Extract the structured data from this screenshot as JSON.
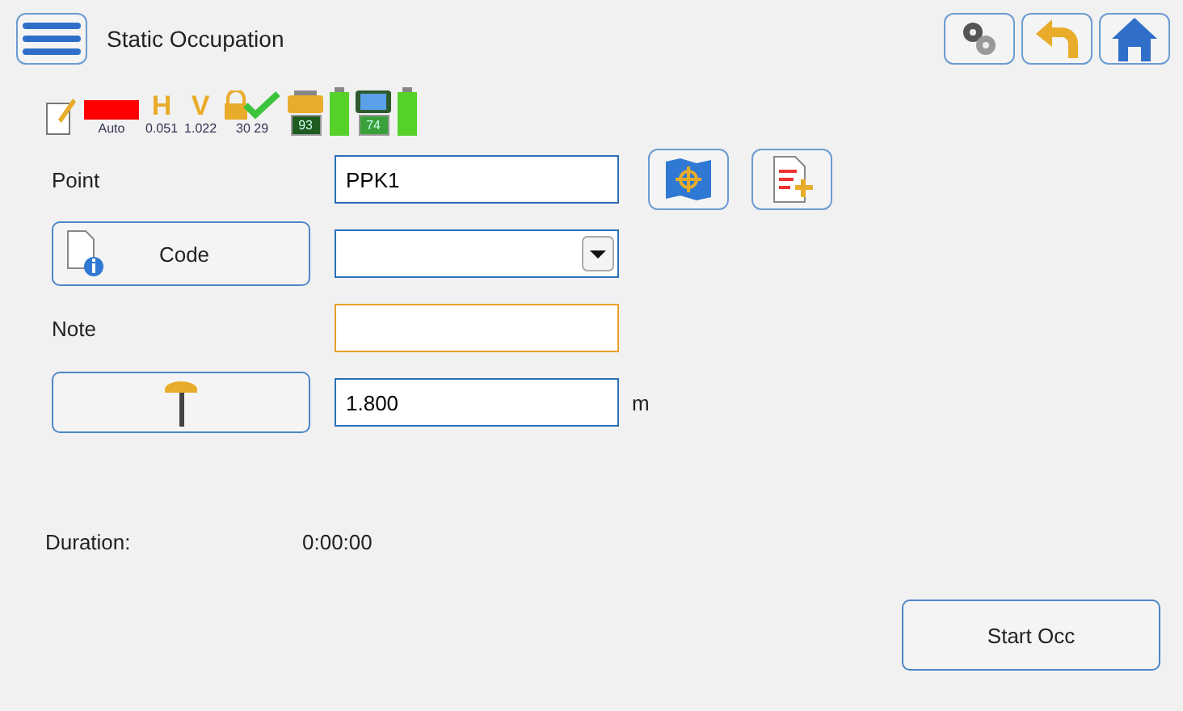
{
  "title": "Static Occupation",
  "status": {
    "mode": "Auto",
    "h_letter": "H",
    "h": "0.051",
    "v_letter": "V",
    "v": "1.022",
    "sats": "30 29",
    "battery_1": "93",
    "battery_2": "74"
  },
  "point": {
    "label": "Point",
    "value": "PPK1"
  },
  "code": {
    "label": "Code"
  },
  "note": {
    "label": "Note"
  },
  "height": {
    "value": "1.800",
    "unit": "m"
  },
  "duration": {
    "label": "Duration:",
    "value": "0:00:00"
  },
  "start_button": "Start Occ"
}
